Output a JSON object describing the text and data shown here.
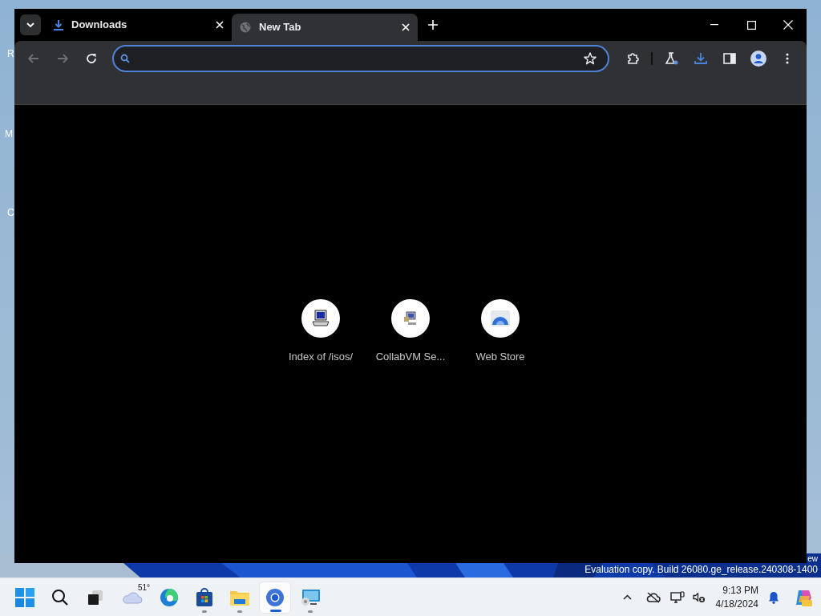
{
  "desktop": {
    "icon_labels": [
      {
        "text": "R"
      },
      {
        "text": "M"
      },
      {
        "text": "C"
      }
    ],
    "watermark_lines": [
      "ew",
      "Evaluation copy. Build 26080.ge_release.240308-1400"
    ]
  },
  "browser": {
    "tabs": [
      {
        "title": "Downloads",
        "kind": "download",
        "selected": false
      },
      {
        "title": "New Tab",
        "kind": "globe",
        "selected": true
      }
    ],
    "shortcuts": [
      {
        "title": "Index of /isos/",
        "kind": "computer"
      },
      {
        "title": "CollabVM Se...",
        "kind": "network"
      },
      {
        "title": "Web Store",
        "kind": "store"
      }
    ]
  },
  "taskbar": {
    "weather": "51°",
    "apps": [
      {
        "kind": "edge",
        "running": false,
        "selected": false
      },
      {
        "kind": "store",
        "running": true,
        "selected": false
      },
      {
        "kind": "explorer",
        "running": true,
        "selected": false
      },
      {
        "kind": "chrome",
        "running": true,
        "selected": true
      },
      {
        "kind": "remote",
        "running": true,
        "selected": false
      }
    ],
    "time": "9:13 PM",
    "date": "4/18/2024"
  }
}
